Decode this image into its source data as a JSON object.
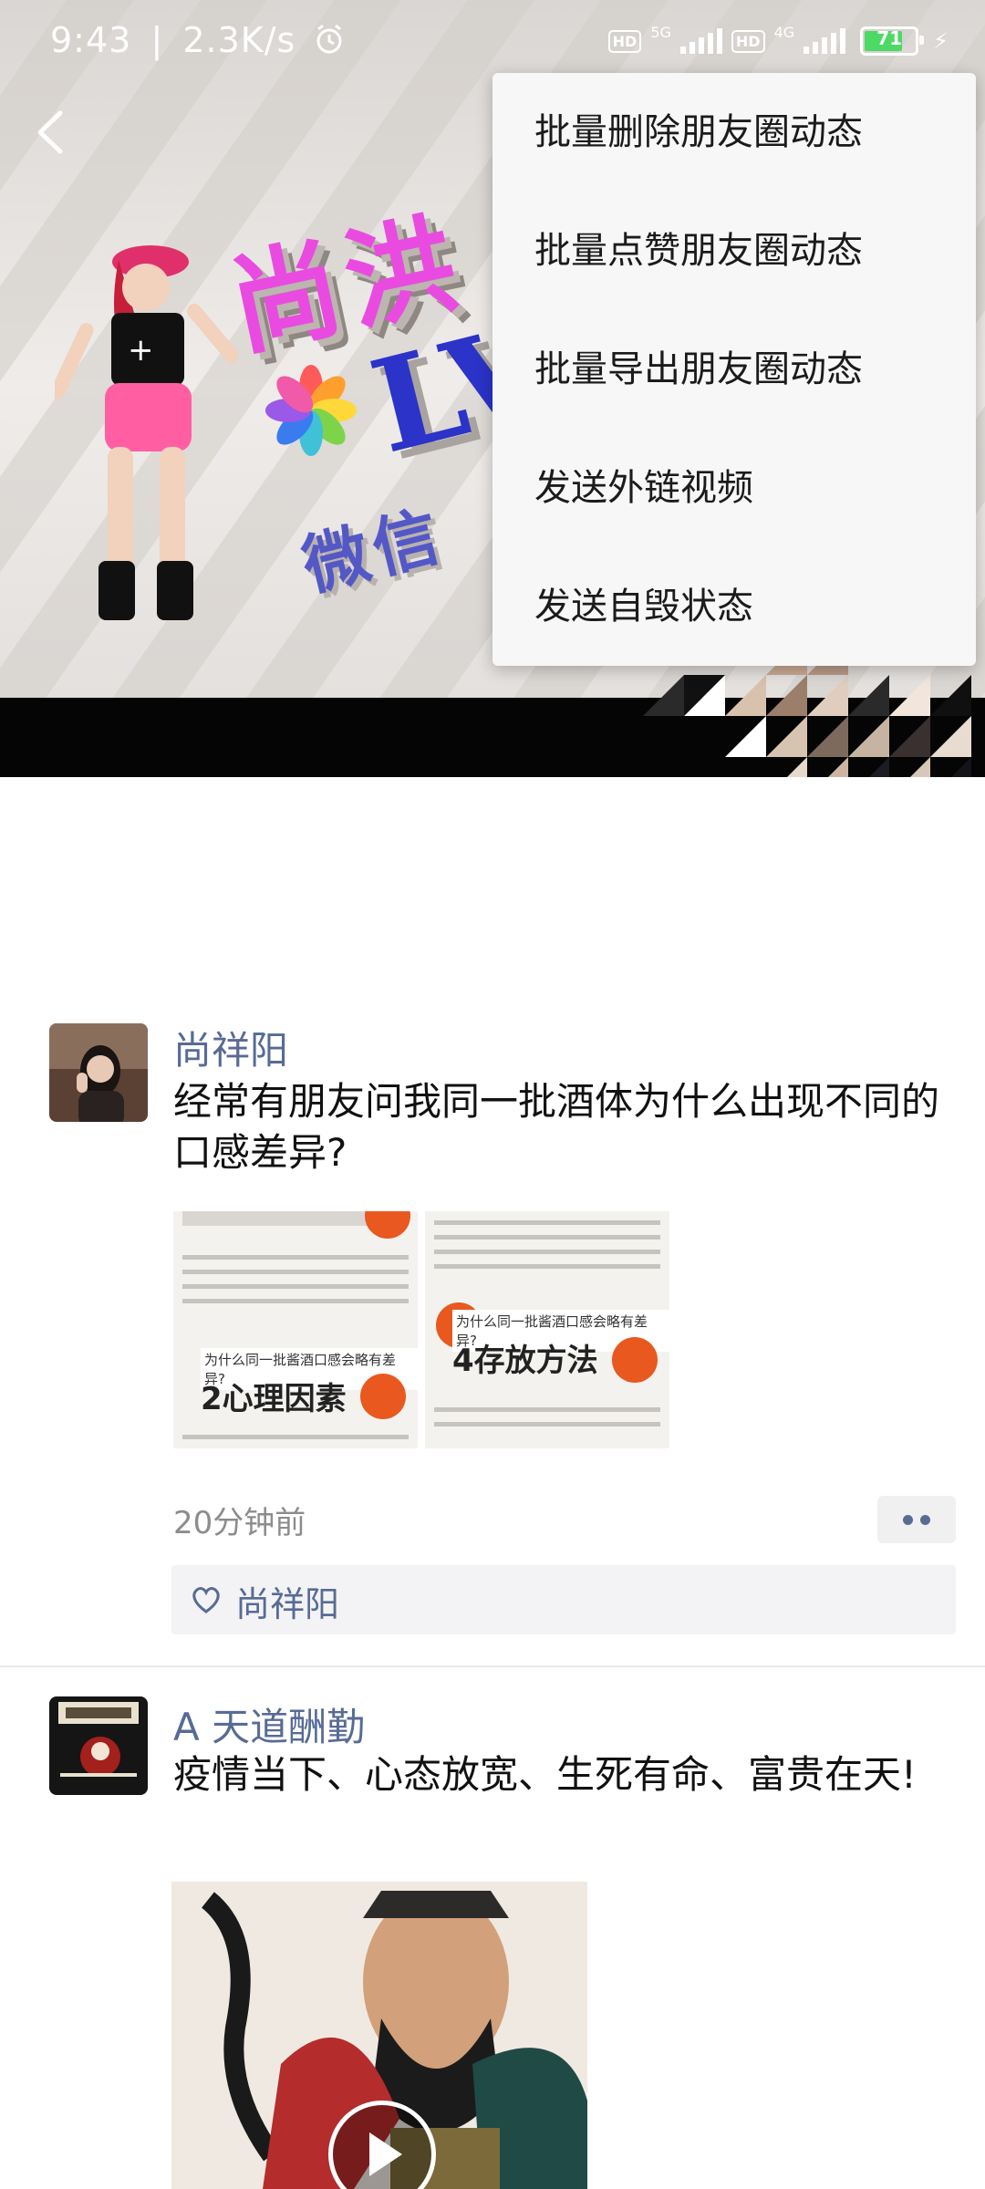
{
  "status_bar": {
    "time": "9:43",
    "speed": "2.3K/s",
    "hd1": "HD",
    "net1": "5G",
    "hd2": "HD",
    "net2": "4G",
    "battery": "71"
  },
  "cover": {
    "title_text": "尚洪",
    "lv_text": "LV",
    "wechat_text": "微信"
  },
  "menu": {
    "items": [
      "批量删除朋友圈动态",
      "批量点赞朋友圈动态",
      "批量导出朋友圈动态",
      "发送外链视频",
      "发送自毁状态"
    ]
  },
  "posts": [
    {
      "nickname": "尚祥阳",
      "content": "经常有朋友问我同一批酒体为什么出现不同的口感差异?",
      "images": [
        {
          "question": "为什么同一批酱酒口感会略有差异?",
          "heading": "2心理因素"
        },
        {
          "question": "为什么同一批酱酒口感会略有差异?",
          "heading": "4存放方法"
        }
      ],
      "time": "20分钟前",
      "likes": [
        "尚祥阳"
      ]
    },
    {
      "nickname": "A 天道酬勤",
      "content": "疫情当下、心态放宽、生死有命、富贵在天!"
    }
  ],
  "colors": {
    "link": "#576b95",
    "menu_bg": "#f7f7f7",
    "battery_fill": "#4cd964"
  }
}
